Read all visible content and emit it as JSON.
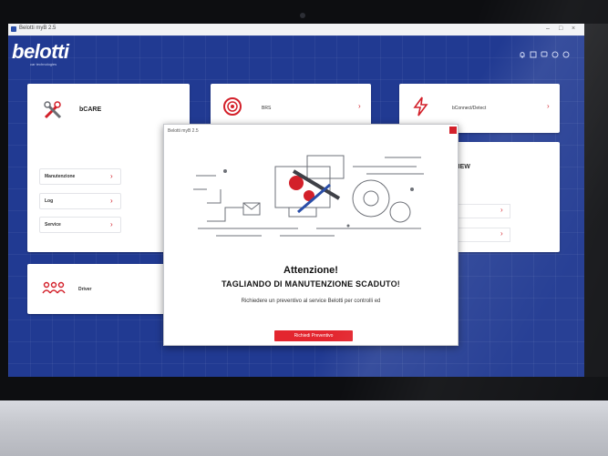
{
  "window": {
    "title": "Belotti myB 2.5",
    "controls": [
      "–",
      "□",
      "×"
    ]
  },
  "brand": {
    "logo": "belotti",
    "tagline": "car technologies"
  },
  "header_icons": [
    "bell-icon",
    "list-icon",
    "chat-icon",
    "gear-icon",
    "user-icon"
  ],
  "cards": {
    "bcare": {
      "title": "bCARE",
      "menu": [
        {
          "label": "Manutenzione"
        },
        {
          "label": "Log"
        },
        {
          "label": "Service"
        }
      ]
    },
    "brs": {
      "label": "BRS"
    },
    "connect": {
      "label": "bConnect/Detect"
    },
    "view": {
      "title": "VIEW"
    },
    "driver": {
      "label": "Driver"
    }
  },
  "modal": {
    "title": "Belotti myB 2.5",
    "heading": "Attenzione!",
    "subheading": "TAGLIANDO DI MANUTENZIONE SCADUTO!",
    "message": "Richiedere un preventivo al service Belotti per controlli ed",
    "button": "Richiedi Preventivo"
  },
  "colors": {
    "screen_bg": "#213a92",
    "accent": "#d3202a",
    "card_bg": "#ffffff"
  }
}
